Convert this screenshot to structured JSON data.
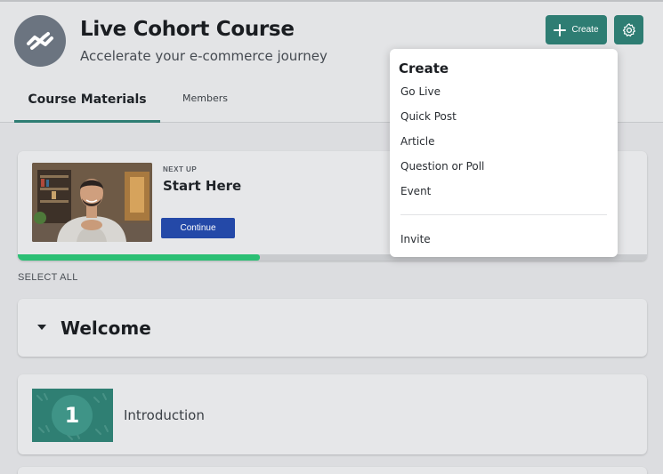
{
  "header": {
    "title": "Live Cohort Course",
    "subtitle": "Accelerate your e-commerce journey",
    "create_label": "Create",
    "accent_color": "#2e7d73"
  },
  "tabs": [
    {
      "label": "Course Materials",
      "active": true
    },
    {
      "label": "Members",
      "active": false
    }
  ],
  "up_next": {
    "eyebrow": "NEXT UP",
    "title": "Start Here",
    "button_label": "Continue",
    "progress": 0.385
  },
  "select_all_label": "SELECT ALL",
  "section": {
    "title": "Welcome"
  },
  "lesson": {
    "number": "1",
    "title": "Introduction"
  },
  "create_menu": {
    "heading": "Create",
    "items": [
      "Go Live",
      "Quick Post",
      "Article",
      "Question or Poll",
      "Event"
    ],
    "footer_item": "Invite"
  }
}
